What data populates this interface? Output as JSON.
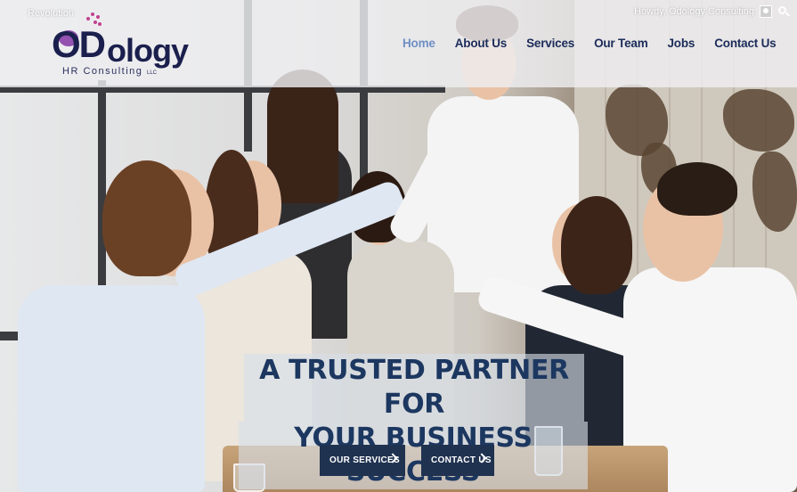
{
  "topbar": {
    "site_name": "Revolution",
    "greeting": "Howdy, Odology Consulting"
  },
  "logo": {
    "mark": "OD",
    "word": "ology",
    "subtitle": "HR Consulting",
    "suffix": "LLC"
  },
  "nav": {
    "items": [
      {
        "label": "Home",
        "active": true
      },
      {
        "label": "About Us",
        "active": false
      },
      {
        "label": "Services",
        "active": false
      },
      {
        "label": "Our Team",
        "active": false
      },
      {
        "label": "Jobs",
        "active": false
      },
      {
        "label": "Contact Us",
        "active": false
      }
    ]
  },
  "hero": {
    "headline_line1": "A TRUSTED PARTNER FOR",
    "headline_line2": "YOUR BUSINESS SUCCESS",
    "cta_services": "OUR SERVICES",
    "cta_contact": "CONTACT US"
  },
  "icons": {
    "avatar": "user-avatar-icon",
    "search": "search-icon",
    "chevron": "chevron-right-icon"
  },
  "colors": {
    "brand_navy": "#1b2c5a",
    "nav_active": "#6f8fc4",
    "cta_bg": "#1f3250",
    "headline": "#1c3760",
    "logo_accent": "#c2408e"
  }
}
